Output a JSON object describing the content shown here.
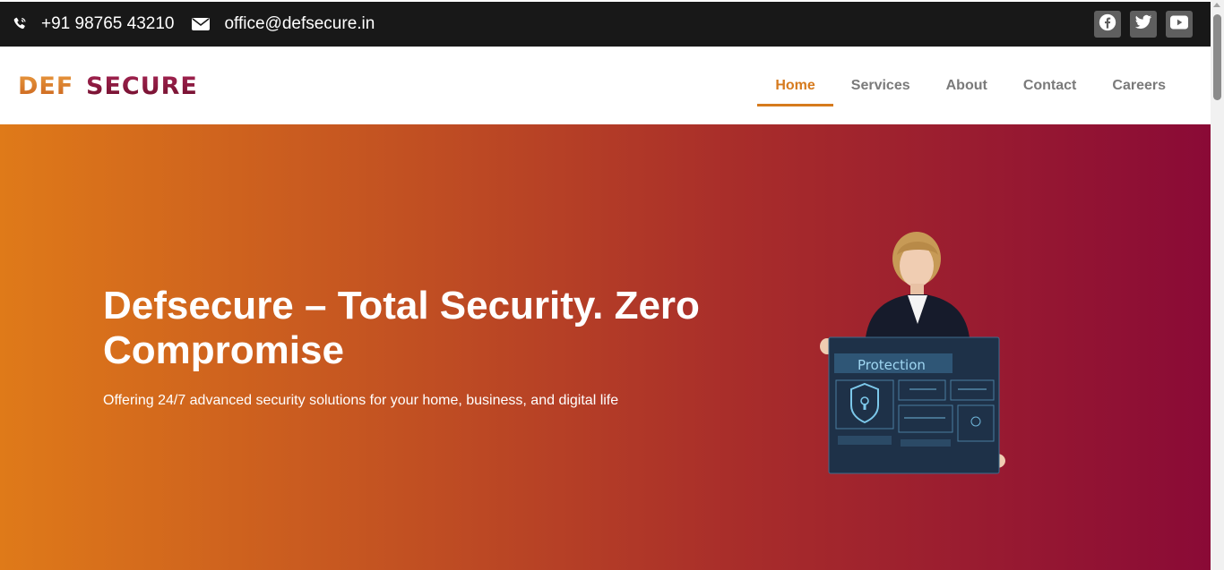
{
  "topbar": {
    "phone": "+91 98765 43210",
    "email": "office@defsecure.in",
    "phone_icon": "phone-icon",
    "email_icon": "envelope-icon",
    "social": [
      {
        "icon": "facebook-icon"
      },
      {
        "icon": "twitter-icon"
      },
      {
        "icon": "youtube-icon"
      }
    ]
  },
  "header": {
    "logo": {
      "part1": "DEF",
      "part2": "SECURE"
    },
    "nav": [
      {
        "label": "Home",
        "active": true
      },
      {
        "label": "Services"
      },
      {
        "label": "About"
      },
      {
        "label": "Contact"
      },
      {
        "label": "Careers"
      }
    ]
  },
  "hero": {
    "title": "Defsecure – Total Security. Zero Compromise",
    "subtitle": "Offering 24/7 advanced security solutions for your home, business, and digital life",
    "image_caption": "Protection"
  },
  "colors": {
    "accent": "#d67a1d",
    "logo_orange": "#d9782a",
    "logo_maroon": "#8a1538",
    "gradient_start": "#df7a19",
    "gradient_end": "#8a0a36"
  }
}
